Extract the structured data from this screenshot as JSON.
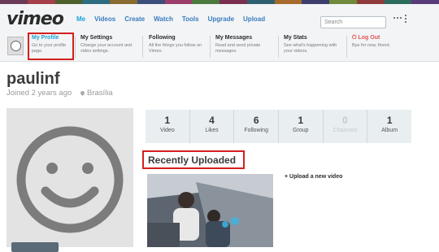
{
  "header": {
    "logo": "vimeo",
    "nav": [
      "Me",
      "Videos",
      "Create",
      "Watch",
      "Tools",
      "Upgrade",
      "Upload"
    ],
    "search_placeholder": "Search",
    "stripe_colors": [
      "#6b3b5a",
      "#a43f4b",
      "#4d5f2a",
      "#2c6e7f",
      "#8a6b2f",
      "#3b4f7a",
      "#9c3e6b",
      "#4a7a3d",
      "#7b2f4f",
      "#2f5f6f",
      "#a66a2a",
      "#3e3e6e",
      "#6f8a3b",
      "#8f3b3b",
      "#2b6b5b",
      "#5a3b7a"
    ]
  },
  "menu": {
    "items": [
      {
        "title": "My Profile",
        "desc": "Go to your profile page."
      },
      {
        "title": "My Settings",
        "desc": "Change your account and video settings."
      },
      {
        "title": "Following",
        "desc": "All the things you follow on Vimeo."
      },
      {
        "title": "My Messages",
        "desc": "Read and send private messages."
      },
      {
        "title": "My Stats",
        "desc": "See what's happening with your videos."
      },
      {
        "title": "Log Out",
        "desc": "Bye for now, friend."
      }
    ]
  },
  "profile": {
    "username": "paulinf",
    "joined": "Joined 2 years ago",
    "location": "Brasília"
  },
  "stats": [
    {
      "value": "1",
      "label": "Video",
      "dim": false
    },
    {
      "value": "4",
      "label": "Likes",
      "dim": false
    },
    {
      "value": "6",
      "label": "Following",
      "dim": false
    },
    {
      "value": "1",
      "label": "Group",
      "dim": false
    },
    {
      "value": "0",
      "label": "Channels",
      "dim": true
    },
    {
      "value": "1",
      "label": "Album",
      "dim": false
    }
  ],
  "recent": {
    "title": "Recently Uploaded",
    "upload_link": "+ Upload a new video"
  },
  "colors": {
    "accent": "#1aa3d9",
    "highlight": "#d51f1f",
    "logout": "#e05353"
  }
}
